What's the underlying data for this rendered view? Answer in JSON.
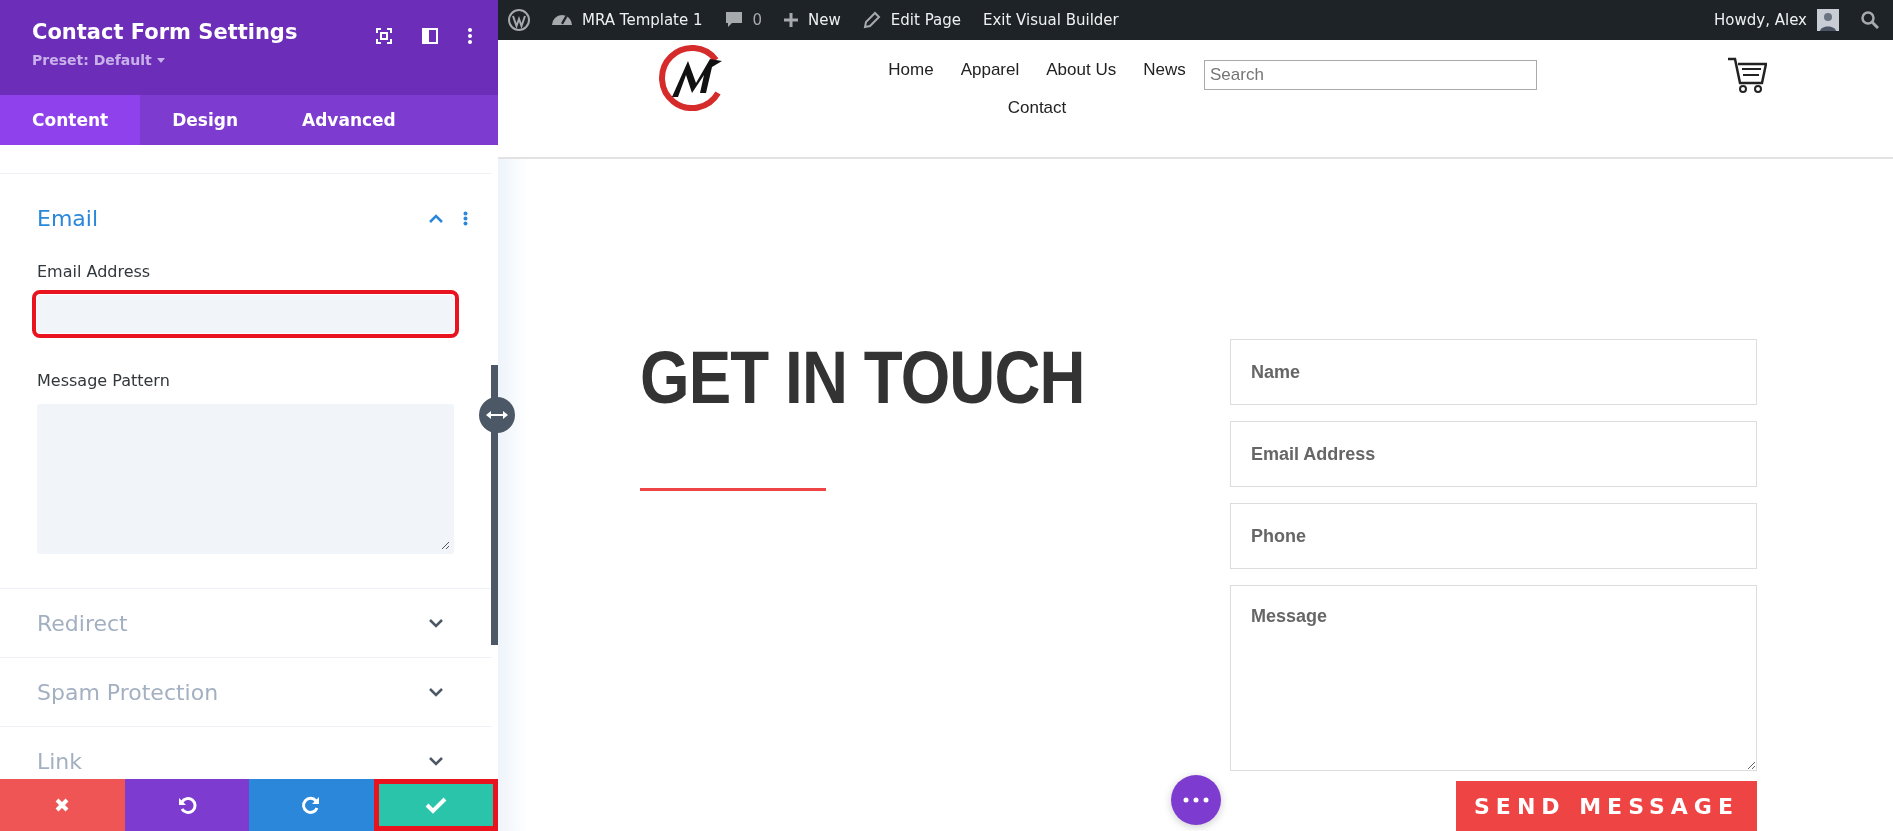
{
  "panel": {
    "title": "Contact Form Settings",
    "preset": "Preset: Default",
    "tabs": [
      {
        "label": "Content",
        "selected": true
      },
      {
        "label": "Design",
        "selected": false
      },
      {
        "label": "Advanced",
        "selected": false
      }
    ],
    "sections": [
      {
        "title": "Email",
        "expanded": true,
        "fields": [
          {
            "label": "Email Address",
            "kind": "input",
            "highlighted": true
          },
          {
            "label": "Message Pattern",
            "kind": "textarea",
            "highlighted": false
          }
        ]
      },
      {
        "title": "Redirect",
        "expanded": false
      },
      {
        "title": "Spam Protection",
        "expanded": false
      },
      {
        "title": "Link",
        "expanded": false
      }
    ],
    "actions": [
      {
        "kind": "discard",
        "highlighted": false
      },
      {
        "kind": "undo",
        "highlighted": false
      },
      {
        "kind": "redo",
        "highlighted": false
      },
      {
        "kind": "save",
        "highlighted": true
      }
    ]
  },
  "admin_bar": {
    "items": [
      {
        "kind": "wp"
      },
      {
        "kind": "dashboard",
        "label": "MRA Template 1"
      },
      {
        "kind": "comments",
        "label": "0"
      },
      {
        "kind": "new",
        "label": "New"
      },
      {
        "kind": "edit",
        "label": "Edit Page"
      },
      {
        "kind": "text",
        "label": "Exit Visual Builder"
      }
    ],
    "greeting": "Howdy, Alex"
  },
  "site": {
    "nav": [
      "Home",
      "Apparel",
      "About Us",
      "News",
      "Contact"
    ],
    "search": {
      "placeholder": "Search"
    }
  },
  "contact": {
    "heading": "GET IN TOUCH",
    "fields": [
      {
        "placeholder": "Name",
        "kind": "input"
      },
      {
        "placeholder": "Email Address",
        "kind": "input"
      },
      {
        "placeholder": "Phone",
        "kind": "input"
      },
      {
        "placeholder": "Message",
        "kind": "textarea"
      }
    ],
    "submit": "SEND MESSAGE"
  }
}
